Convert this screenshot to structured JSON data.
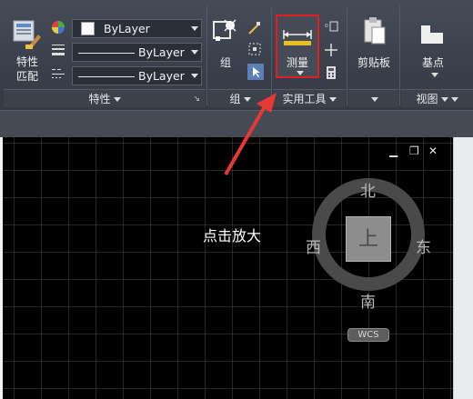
{
  "ribbon": {
    "properties_panel": {
      "match_properties_label": "特性\n匹配",
      "color_dropdown": "ByLayer",
      "linetype_dropdown": "ByLayer",
      "lineweight_dropdown": "ByLayer",
      "title": "特性"
    },
    "group_panel": {
      "group_label": "组",
      "title": "组"
    },
    "utilities_panel": {
      "measure_label": "测量",
      "title": "实用工具"
    },
    "clipboard_panel": {
      "clipboard_label": "剪贴板"
    },
    "view_panel": {
      "basepoint_label": "基点",
      "title": "视图"
    }
  },
  "annotation": {
    "text": "点击放大",
    "color": "#e53935"
  },
  "viewcube": {
    "north": "北",
    "south": "南",
    "east": "东",
    "west": "西",
    "top_face": "上",
    "wcs": "WCS"
  },
  "window_controls": {
    "minimize": "▁",
    "restore": "❐",
    "close": "✕"
  },
  "colors": {
    "highlight": "#e02020",
    "canvas": "#000000",
    "ribbon": "#3f4550"
  }
}
